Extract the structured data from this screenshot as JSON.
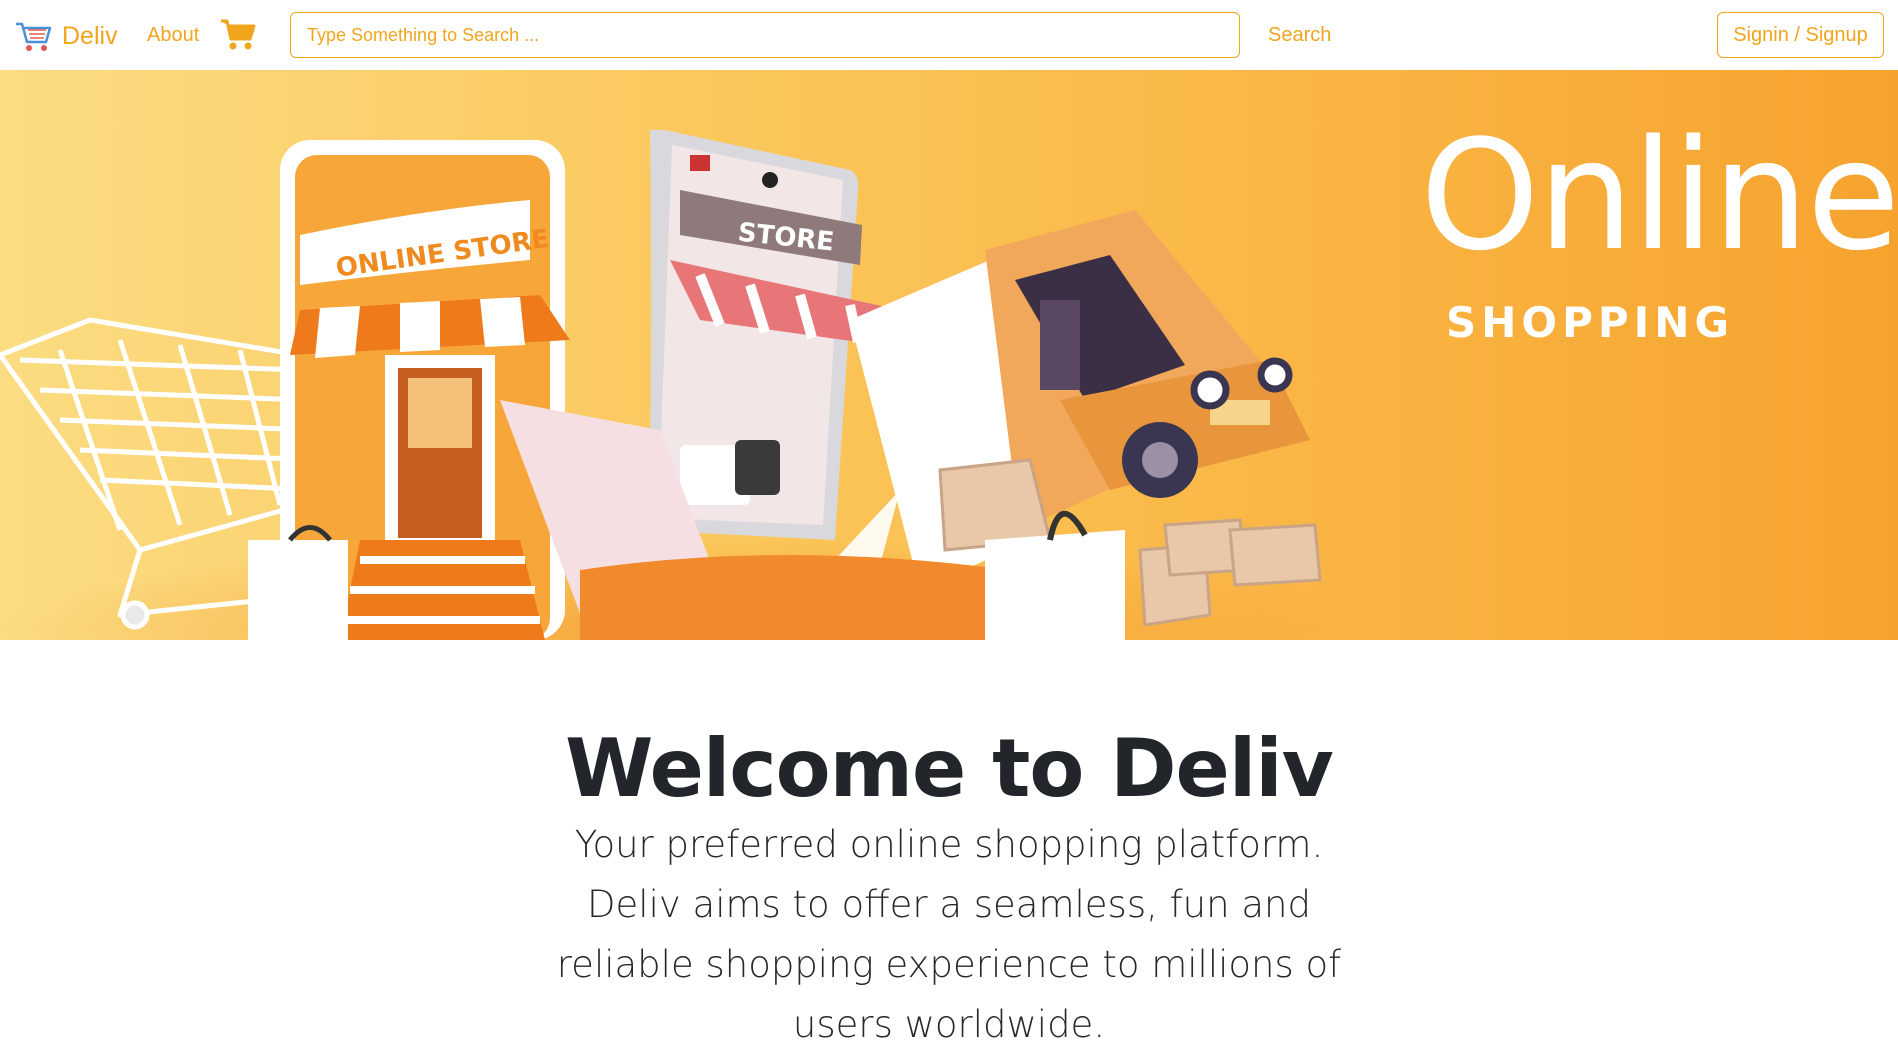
{
  "navbar": {
    "brand": "Deliv",
    "about": "About",
    "search_placeholder": "Type Something to Search ...",
    "search_button": "Search",
    "signin_button": "Signin / Signup"
  },
  "hero": {
    "title": "Online.",
    "subtitle": "SHOPPING",
    "store_sign": "ONLINE STORE",
    "phone_sign": "STORE"
  },
  "main": {
    "heading": "Welcome to Deliv",
    "tagline": "Your preferred online shopping platform. Deliv aims to offer a seamless, fun and reliable shopping experience to millions of users worldwide."
  },
  "colors": {
    "accent": "#f0a51d",
    "text_dark": "#22252a",
    "hero_start": "#fbdc82",
    "hero_end": "#f6a32e"
  },
  "icons": [
    "cart-logo-icon",
    "cart-icon"
  ]
}
